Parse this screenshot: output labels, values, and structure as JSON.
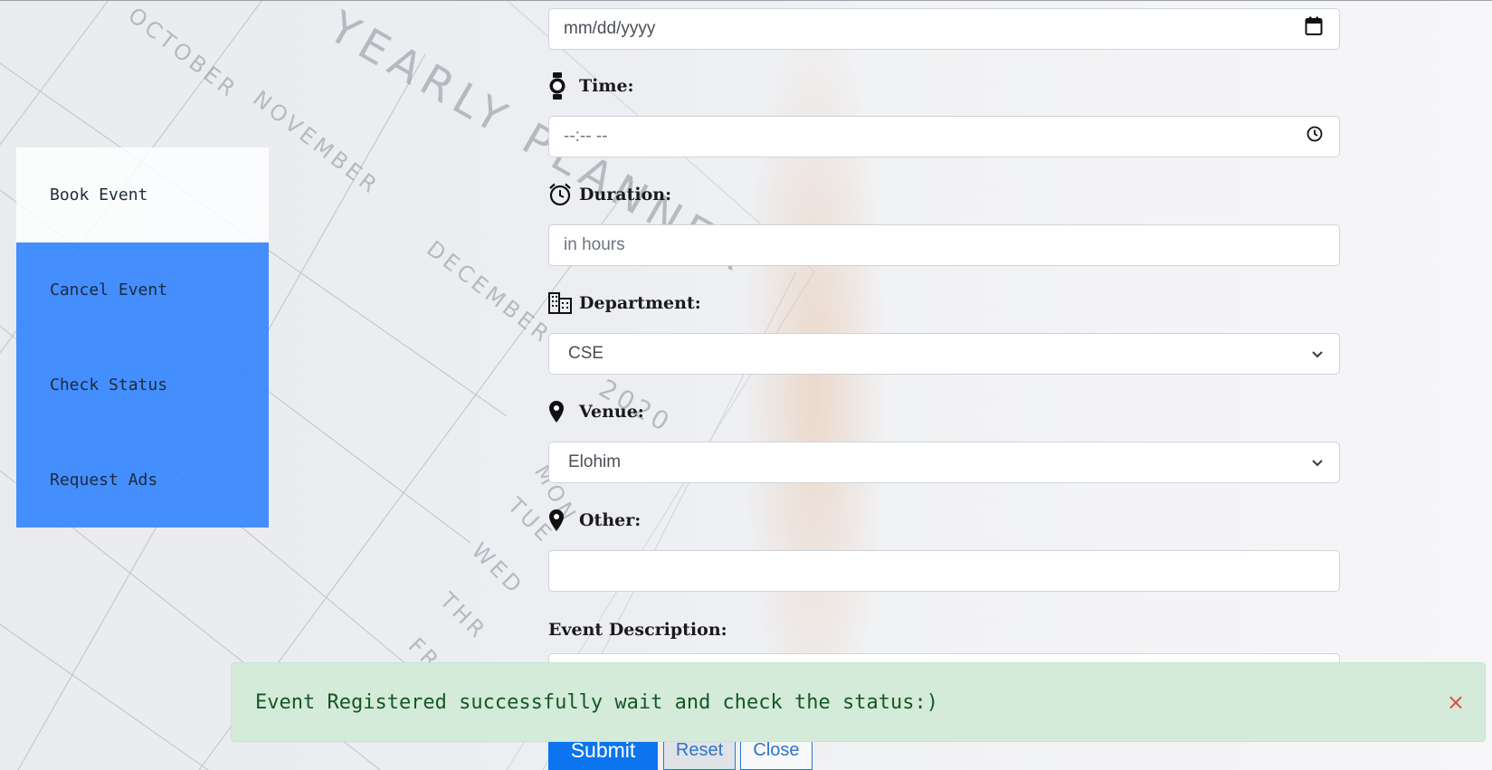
{
  "sidebar": {
    "items": [
      {
        "label": "Book Event"
      },
      {
        "label": "Cancel Event"
      },
      {
        "label": "Check Status"
      },
      {
        "label": "Request Ads"
      }
    ]
  },
  "form": {
    "date": {
      "placeholder": "mm/dd/yyyy"
    },
    "time": {
      "label": "Time:",
      "placeholder": "--:-- --"
    },
    "duration": {
      "label": "Duration:",
      "placeholder": "in hours"
    },
    "department": {
      "label": "Department:",
      "selected": "CSE"
    },
    "venue": {
      "label": "Venue:",
      "selected": "Elohim"
    },
    "other": {
      "label": "Other:",
      "value": ""
    },
    "description": {
      "label": "Event Description:"
    }
  },
  "buttons": {
    "submit": "Submit",
    "reset": "Reset",
    "close": "Close"
  },
  "alert": {
    "message": "Event Registered successfully wait and check the status:)",
    "close_glyph": "×"
  },
  "background": {
    "printed_text": {
      "title": "YEARLY PLANNER",
      "year": "2020",
      "months": [
        "OCTOBER",
        "NOVEMBER",
        "DECEMBER"
      ],
      "days": [
        "MON",
        "TUE",
        "WED",
        "THR",
        "FRI"
      ]
    }
  },
  "colors": {
    "sidebar_active": "#ffffff",
    "sidebar_item": "#3284ff",
    "submit": "#0b74ee",
    "alert_bg": "#d4ebd9",
    "alert_text": "#155724"
  },
  "icons": {
    "time": "watch-icon",
    "duration": "alarm-clock-icon",
    "department": "building-icon",
    "venue": "map-pin-icon",
    "other": "map-pin-icon"
  }
}
